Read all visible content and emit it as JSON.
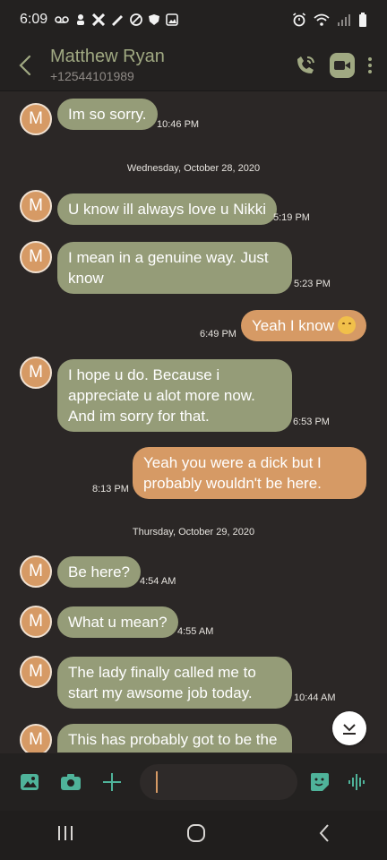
{
  "status_bar": {
    "time": "6:09"
  },
  "header": {
    "contact_name": "Matthew Ryan",
    "contact_number": "+12544101989"
  },
  "messages": [
    {
      "kind": "in",
      "avatar": "M",
      "text": "Im so sorry.",
      "time": "10:46 PM"
    },
    {
      "kind": "date",
      "text": "Wednesday, October 28, 2020"
    },
    {
      "kind": "in",
      "avatar": "M",
      "text": "U know ill always love u Nikki",
      "time": "5:19 PM"
    },
    {
      "kind": "in",
      "avatar": "M",
      "text": "I mean in a genuine way. Just know",
      "time": "5:23 PM"
    },
    {
      "kind": "out",
      "text": "Yeah I know",
      "time": "6:49 PM"
    },
    {
      "kind": "in",
      "avatar": "M",
      "text": "I hope u do. Because i appreciate u alot more now. And im sorry for that.",
      "time": "6:53 PM"
    },
    {
      "kind": "out",
      "text": "Yeah you were a dick but I probably wouldn't be here.",
      "time": "8:13 PM"
    },
    {
      "kind": "date",
      "text": "Thursday, October 29, 2020"
    },
    {
      "kind": "in",
      "avatar": "M",
      "text": "Be here?",
      "time": "4:54 AM"
    },
    {
      "kind": "in",
      "avatar": "M",
      "text": "What u mean?",
      "time": "4:55 AM"
    },
    {
      "kind": "in",
      "avatar": "M",
      "text": "The lady finally called me to start my awsome job today.",
      "time": "10:44 AM"
    },
    {
      "kind": "in",
      "avatar": "M",
      "text": "This has probably got to be the",
      "time": ""
    }
  ],
  "colors": {
    "incoming_bubble": "#959c78",
    "outgoing_bubble": "#d69a65",
    "accent_green": "#4fb39a",
    "background": "#2b2726"
  },
  "icons": {
    "back": "chevron-left-icon",
    "call": "wifi-call-icon",
    "video": "video-icon",
    "menu": "more-vert-icon",
    "gallery": "image-icon",
    "camera": "camera-icon",
    "add": "plus-icon",
    "sticker": "sticker-icon",
    "voice": "voice-wave-icon",
    "scroll_down": "arrow-down-icon"
  }
}
